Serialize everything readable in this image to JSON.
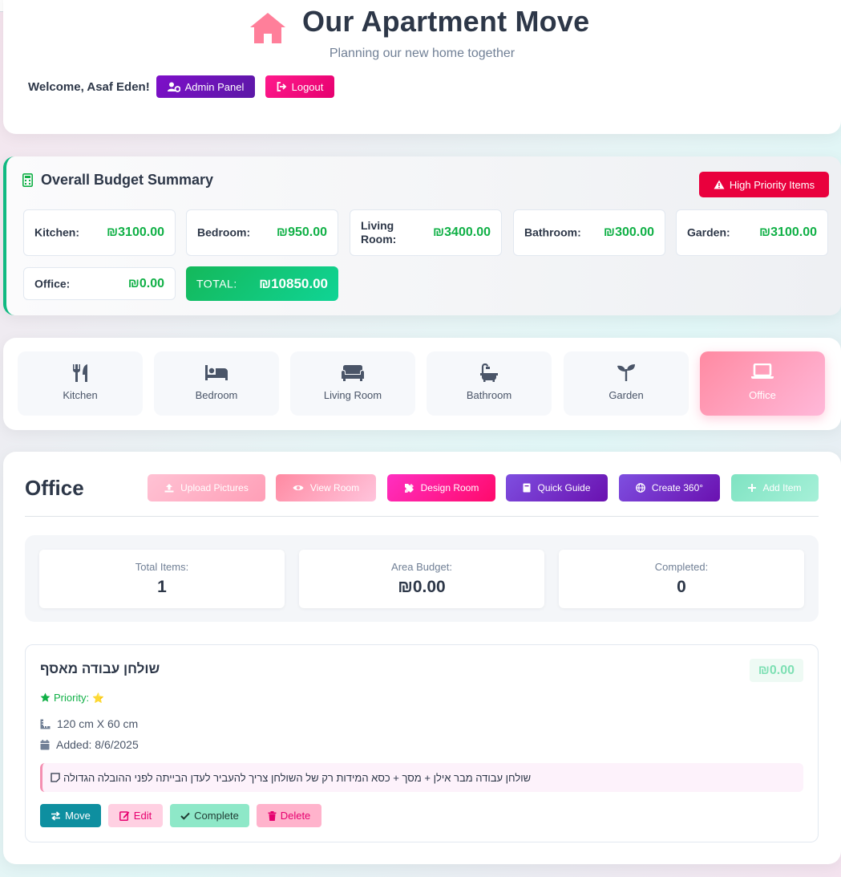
{
  "header": {
    "title": "Our Apartment Move",
    "subtitle": "Planning our new home together",
    "welcome": "Welcome, Asaf Eden!",
    "admin_label": "Admin Panel",
    "logout_label": "Logout"
  },
  "budget": {
    "title": "Overall Budget Summary",
    "high_priority_label": "High Priority Items",
    "rows": [
      {
        "label": "Kitchen:",
        "value": "₪3100.00"
      },
      {
        "label": "Bedroom:",
        "value": "₪950.00"
      },
      {
        "label": "Living Room:",
        "value": "₪3400.00"
      },
      {
        "label": "Bathroom:",
        "value": "₪300.00"
      },
      {
        "label": "Garden:",
        "value": "₪3100.00"
      },
      {
        "label": "Office:",
        "value": "₪0.00"
      }
    ],
    "total": {
      "label": "TOTAL:",
      "value": "₪10850.00"
    }
  },
  "tabs": [
    {
      "label": "Kitchen",
      "icon": "utensils-icon"
    },
    {
      "label": "Bedroom",
      "icon": "bed-icon"
    },
    {
      "label": "Living Room",
      "icon": "couch-icon"
    },
    {
      "label": "Bathroom",
      "icon": "bath-icon"
    },
    {
      "label": "Garden",
      "icon": "seedling-icon"
    },
    {
      "label": "Office",
      "icon": "laptop-icon",
      "active": true
    }
  ],
  "area": {
    "title": "Office",
    "actions": {
      "upload": "Upload Pictures",
      "view": "View Room",
      "design": "Design Room",
      "guide": "Quick Guide",
      "create360": "Create 360°",
      "add": "Add Item"
    },
    "stats": [
      {
        "label": "Total Items:",
        "value": "1"
      },
      {
        "label": "Area Budget:",
        "value": "₪0.00"
      },
      {
        "label": "Completed:",
        "value": "0"
      }
    ]
  },
  "items": [
    {
      "name": "שולחן עבודה מאסף",
      "price": "₪0.00",
      "priority_label": "Priority:",
      "priority_stars": "⭐",
      "dimensions": "120 cm X 60 cm",
      "added": "Added: 8/6/2025",
      "note": "שולחן עבודה מבר אילן + מסך + כסא המידות רק של השולחן צריך להעביר לעדן הבייתה לפני ההובלה הגדולה",
      "buttons": {
        "move": "Move",
        "edit": "Edit",
        "complete": "Complete",
        "delete": "Delete"
      }
    }
  ],
  "colors": {
    "accent_pink": "#ff1a8c",
    "accent_purple": "#7e0fc9",
    "success_green": "#10b046",
    "danger_red": "#e9003d",
    "teal": "#0e8fa0"
  }
}
